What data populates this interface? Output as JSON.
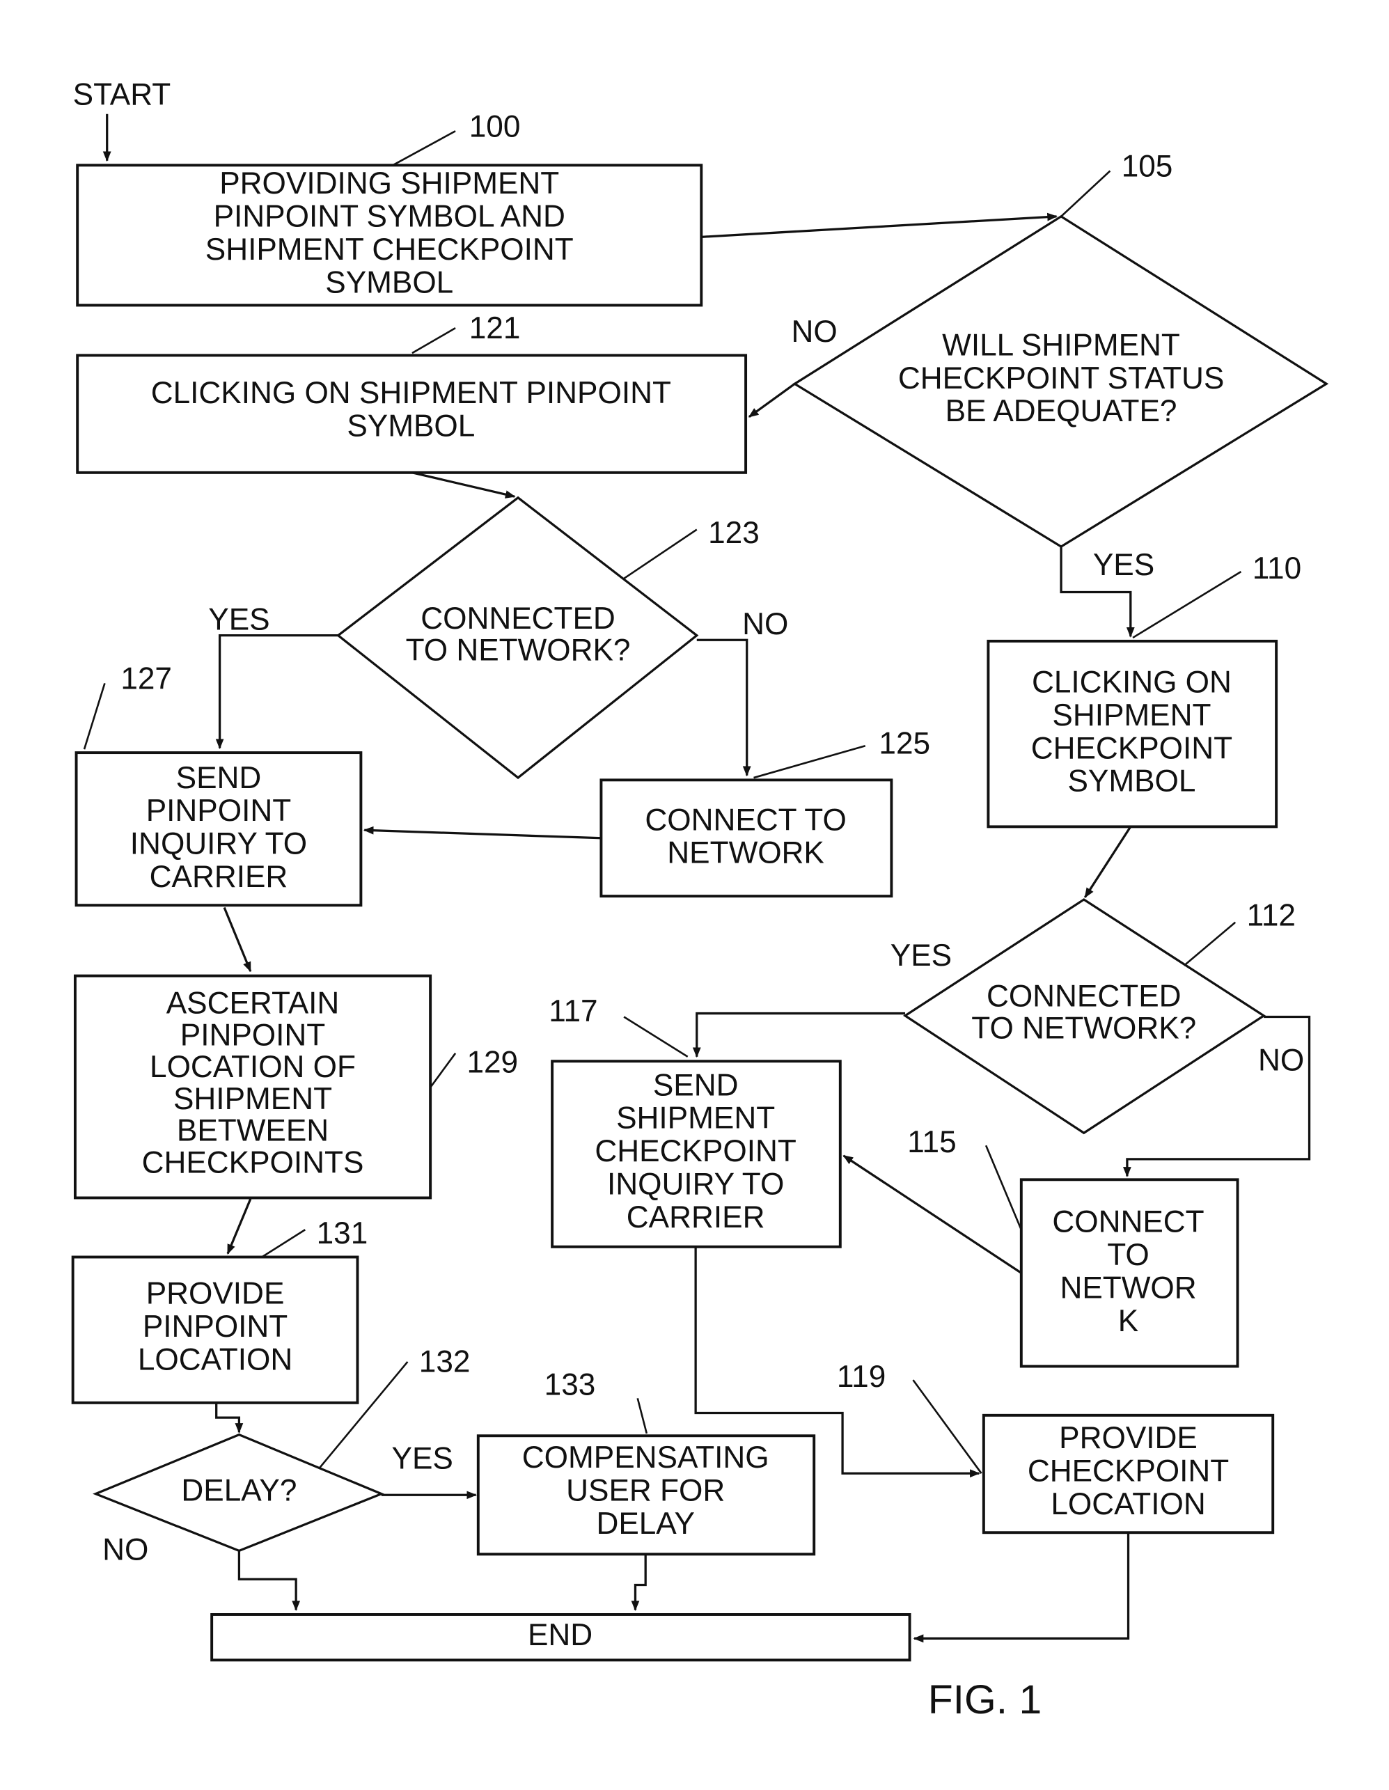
{
  "figure_label": "FIG. 1",
  "start_label": "START",
  "nodes": {
    "n100": {
      "ref": "100",
      "lines": [
        "PROVIDING SHIPMENT",
        "PINPOINT SYMBOL AND",
        "SHIPMENT CHECKPOINT",
        "SYMBOL"
      ]
    },
    "n105": {
      "ref": "105",
      "lines": [
        "WILL SHIPMENT",
        "CHECKPOINT STATUS",
        "BE ADEQUATE?"
      ]
    },
    "n121": {
      "ref": "121",
      "lines": [
        "CLICKING ON SHIPMENT PINPOINT",
        "SYMBOL"
      ]
    },
    "n123": {
      "ref": "123",
      "lines": [
        "CONNECTED",
        "TO NETWORK?"
      ]
    },
    "n125": {
      "ref": "125",
      "lines": [
        "CONNECT TO",
        "NETWORK"
      ]
    },
    "n127": {
      "ref": "127",
      "lines": [
        "SEND",
        "PINPOINT",
        "INQUIRY TO",
        "CARRIER"
      ]
    },
    "n129": {
      "ref": "129",
      "lines": [
        "ASCERTAIN",
        "PINPOINT",
        "LOCATION OF",
        "SHIPMENT",
        "BETWEEN",
        "CHECKPOINTS"
      ]
    },
    "n131": {
      "ref": "131",
      "lines": [
        "PROVIDE",
        "PINPOINT",
        "LOCATION"
      ]
    },
    "n132": {
      "ref": "132",
      "lines": [
        "DELAY?"
      ]
    },
    "n133": {
      "ref": "133",
      "lines": [
        "COMPENSATING",
        "USER FOR",
        "DELAY"
      ]
    },
    "n110": {
      "ref": "110",
      "lines": [
        "CLICKING ON",
        "SHIPMENT",
        "CHECKPOINT",
        "SYMBOL"
      ]
    },
    "n112": {
      "ref": "112",
      "lines": [
        "CONNECTED",
        "TO NETWORK?"
      ]
    },
    "n115": {
      "ref": "115",
      "lines": [
        "CONNECT",
        "TO",
        "NETWOR",
        "K"
      ]
    },
    "n117": {
      "ref": "117",
      "lines": [
        "SEND",
        "SHIPMENT",
        "CHECKPOINT",
        "INQUIRY TO",
        "CARRIER"
      ]
    },
    "n119": {
      "ref": "119",
      "lines": [
        "PROVIDE",
        "CHECKPOINT",
        "LOCATION"
      ]
    },
    "end": {
      "lines": [
        "END"
      ]
    }
  },
  "edge_labels": {
    "n105_no": "NO",
    "n105_yes": "YES",
    "n123_yes": "YES",
    "n123_no": "NO",
    "n112_yes": "YES",
    "n112_no": "NO",
    "n132_yes": "YES",
    "n132_no": "NO"
  }
}
